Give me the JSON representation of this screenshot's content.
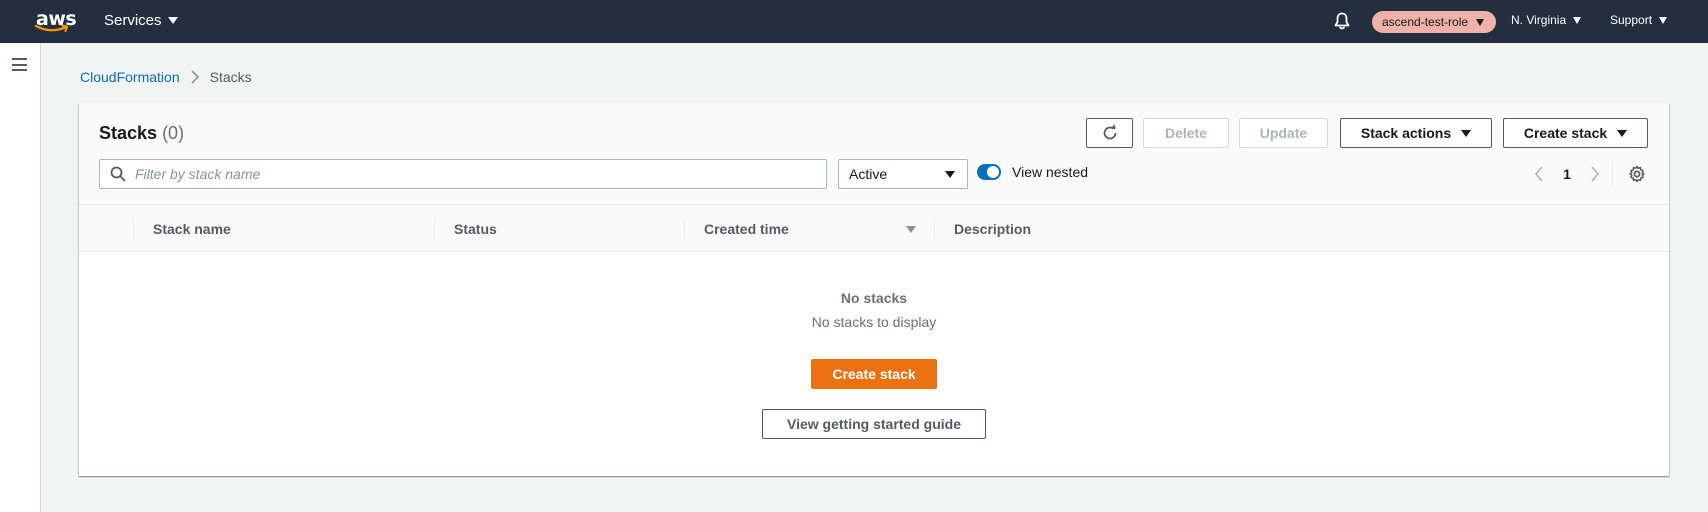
{
  "topnav": {
    "logo_text": "aws",
    "services_label": "Services",
    "role_label": "ascend-test-role",
    "region_label": "N. Virginia",
    "support_label": "Support",
    "bg_color": "#232f3e",
    "role_pill_color": "#f0b2a8"
  },
  "breadcrumb": {
    "items": [
      {
        "label": "CloudFormation"
      },
      {
        "label": "Stacks"
      }
    ]
  },
  "stacks_panel": {
    "title": "Stacks",
    "count": "(0)",
    "buttons": {
      "delete": "Delete",
      "update": "Update",
      "stack_actions": "Stack actions",
      "create_stack": "Create stack"
    },
    "filter": {
      "placeholder": "Filter by stack name",
      "value": ""
    },
    "status_select": {
      "selected": "Active"
    },
    "view_nested": {
      "label": "View nested",
      "enabled": true
    },
    "pagination": {
      "current_page": "1"
    },
    "table": {
      "columns": [
        {
          "label": "Stack name"
        },
        {
          "label": "Status"
        },
        {
          "label": "Created time"
        },
        {
          "label": "Description"
        }
      ],
      "rows": []
    },
    "empty_state": {
      "title": "No stacks",
      "subtitle": "No stacks to display",
      "primary_button": "Create stack",
      "secondary_button": "View getting started guide"
    }
  },
  "colors": {
    "accent": "#0073bb",
    "primary_button": "#ec7211"
  }
}
